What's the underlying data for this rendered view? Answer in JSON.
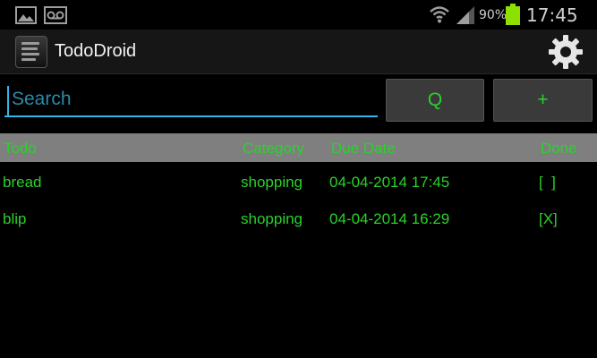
{
  "status_bar": {
    "battery_percent": "90%",
    "time": "17:45",
    "icons": [
      "image-icon",
      "voicemail-icon",
      "wifi-icon",
      "signal-icon",
      "battery-icon"
    ]
  },
  "action_bar": {
    "app_title": "TodoDroid",
    "app_icon": "app-icon",
    "settings_icon": "gear-icon"
  },
  "search": {
    "placeholder": "Search",
    "value": "",
    "search_button_label": "Q",
    "add_button_label": "+"
  },
  "table": {
    "headers": {
      "todo": "Todo",
      "category": "Category",
      "due_date": "Due Date",
      "done": "Done"
    },
    "rows": [
      {
        "todo": "bread",
        "category": "shopping",
        "due_date": "04-04-2014 17:45",
        "done": "[  ]"
      },
      {
        "todo": "blip",
        "category": "shopping",
        "due_date": "04-04-2014 16:29",
        "done": "[X]"
      }
    ]
  },
  "colors": {
    "text_green": "#2bd12b",
    "accent_blue": "#33b5e5",
    "battery_green": "#8ee000",
    "header_gray": "#7f7f7f"
  }
}
